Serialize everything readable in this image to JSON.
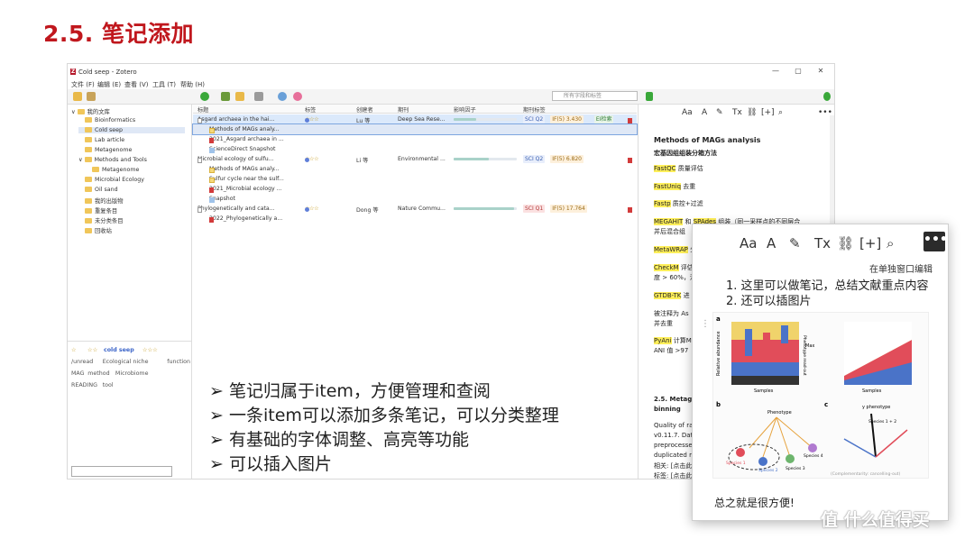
{
  "slide": {
    "title": "2.5. 笔记添加",
    "bullets": [
      "笔记归属于item，方便管理和查阅",
      "一条item可以添加多条笔记，可以分类整理",
      "有基础的字体调整、高亮等功能",
      "可以插入图片"
    ],
    "bullet_glyph": "➢"
  },
  "window": {
    "title": "Cold seep - Zotero",
    "logo_letter": "Z",
    "controls": [
      "—",
      "▢",
      "✕"
    ],
    "menus": [
      "文件 (F)",
      "编辑 (E)",
      "查看 (V)",
      "工具 (T)",
      "帮助 (H)"
    ],
    "search_placeholder": "所有字段和标签"
  },
  "library": {
    "items": [
      {
        "label": "我的文库",
        "level": 0,
        "expand": "∨"
      },
      {
        "label": "Bioinformatics",
        "level": 1
      },
      {
        "label": "Cold seep",
        "level": 1,
        "selected": true
      },
      {
        "label": "Lab article",
        "level": 1
      },
      {
        "label": "Metagenome",
        "level": 1
      },
      {
        "label": "Methods and Tools",
        "level": 1,
        "expand": "∨"
      },
      {
        "label": "Metagenome",
        "level": 2
      },
      {
        "label": "Microbial Ecology",
        "level": 1
      },
      {
        "label": "Oil sand",
        "level": 1
      },
      {
        "label": "我的出版物",
        "level": 1
      },
      {
        "label": "重复条目",
        "level": 1
      },
      {
        "label": "未分类条目",
        "level": 1
      },
      {
        "label": "回收站",
        "level": 1
      }
    ],
    "tags": [
      [
        "☆",
        "☆☆",
        "cold seep",
        "☆☆☆"
      ],
      [
        "/unread",
        "Ecological niche",
        "function"
      ],
      [
        "MAG",
        "method",
        "Microbiome"
      ],
      [
        "READING",
        "tool"
      ]
    ]
  },
  "columns": [
    "标题",
    "标签",
    "创建者",
    "期刊",
    "影响因子",
    "期刊标签"
  ],
  "rows": [
    {
      "kind": "item",
      "title": "Asgard archaea in the hai...",
      "stars": "☆☆☆",
      "creator": "Lu 等",
      "journal": "Deep Sea Rese...",
      "impact": 0.35,
      "badges": [
        "SCI Q2",
        "IF(5) 3.430",
        "EI检索"
      ],
      "highlighted": true
    },
    {
      "kind": "note",
      "title": "Methods of MAGs analy...",
      "selected": true
    },
    {
      "kind": "pdf",
      "title": "2021_Asgard archaea in ..."
    },
    {
      "kind": "snap",
      "title": "ScienceDirect Snapshot"
    },
    {
      "kind": "item",
      "title": "Microbial ecology of sulfu...",
      "stars": "☆☆☆",
      "creator": "Li 等",
      "journal": "Environmental ...",
      "impact": 0.55,
      "badges": [
        "SCI Q2",
        "IF(5) 6.820"
      ]
    },
    {
      "kind": "note",
      "title": "Methods of MAGs analy..."
    },
    {
      "kind": "note",
      "title": "Sulfur cycle near the sulf..."
    },
    {
      "kind": "pdf",
      "title": "2021_Microbial ecology ..."
    },
    {
      "kind": "snap",
      "title": "Snapshot"
    },
    {
      "kind": "item",
      "title": "Phylogenetically and cata...",
      "stars": "☆☆☆",
      "creator": "Dong 等",
      "journal": "Nature Commu...",
      "impact": 0.95,
      "badges": [
        "SCI Q1",
        "IF(5) 17.764"
      ]
    },
    {
      "kind": "pdf",
      "title": "2022_Phylogenetically a..."
    }
  ],
  "note": {
    "toolbar": [
      "Aa",
      "A",
      "✎",
      "Tx",
      "⛓",
      "[+]",
      "⌕",
      "•••"
    ],
    "lines": [
      {
        "text": "Methods of MAGs analysis",
        "bold": true,
        "size": 8
      },
      {
        "text": "宏基因组组装分箱方法",
        "bold": true
      },
      {
        "hl": "FastQC",
        "text": " 质量评估"
      },
      {
        "hl": "FastUniq",
        "text": " 去重"
      },
      {
        "hl": "Fastp",
        "text": " 质控+过滤"
      },
      {
        "hl": "MEGAHIT",
        "text": " 和 ",
        "hl2": "SPAdes",
        "text2": " 组装（同一采样点的不同层合"
      },
      {
        "text": "并后混合组"
      },
      {
        "hl": "MetaWRAP",
        "text": " 分"
      },
      {
        "hl": "CheckM",
        "text": " 评估"
      },
      {
        "text": "度 > 60%，污"
      },
      {
        "hl": "GTDB-TK",
        "text": " 进"
      },
      {
        "text": "被注释为 As"
      },
      {
        "text": "并去重"
      },
      {
        "hl": "PyAni",
        "text": " 计算M"
      },
      {
        "text": "ANI 值 >97"
      },
      {
        "text": "2.5. Metage",
        "bold": true
      },
      {
        "text": "binning",
        "bold": true
      },
      {
        "text": "Quality of ra"
      },
      {
        "text": "v0.11.7. Dat"
      },
      {
        "text": "preprocessed"
      },
      {
        "text": "duplicated r"
      },
      {
        "text": "相关: [点击此"
      },
      {
        "text": "标签: [点击此"
      }
    ]
  },
  "popup": {
    "tooltip": "在单独窗口编辑",
    "lines": [
      "1. 这里可以做笔记，总结文献重点内容",
      "2. 还可以插图片"
    ],
    "footer": "总之就是很方便!",
    "figure": {
      "panel_a": "a",
      "panel_b": "b",
      "panel_c": "c",
      "x_label": "Samples",
      "y_label": "Relative abundance",
      "y_right": "Phenotype read-out",
      "phenotype": "Phenotype",
      "y_phenotype": "y phenotype",
      "max_label": "Max",
      "species": [
        "Species 1",
        "Species 2",
        "Species 3",
        "Species 4",
        "Species 1 + 2"
      ],
      "signs": [
        "(+)",
        "(−)",
        "(−)",
        "(+)",
        "(+)"
      ],
      "complementarity": "(Complementarity: cancelling-out)",
      "side_note": "(Complementarity: adding-up)"
    }
  },
  "watermark": "值 什么值得买"
}
